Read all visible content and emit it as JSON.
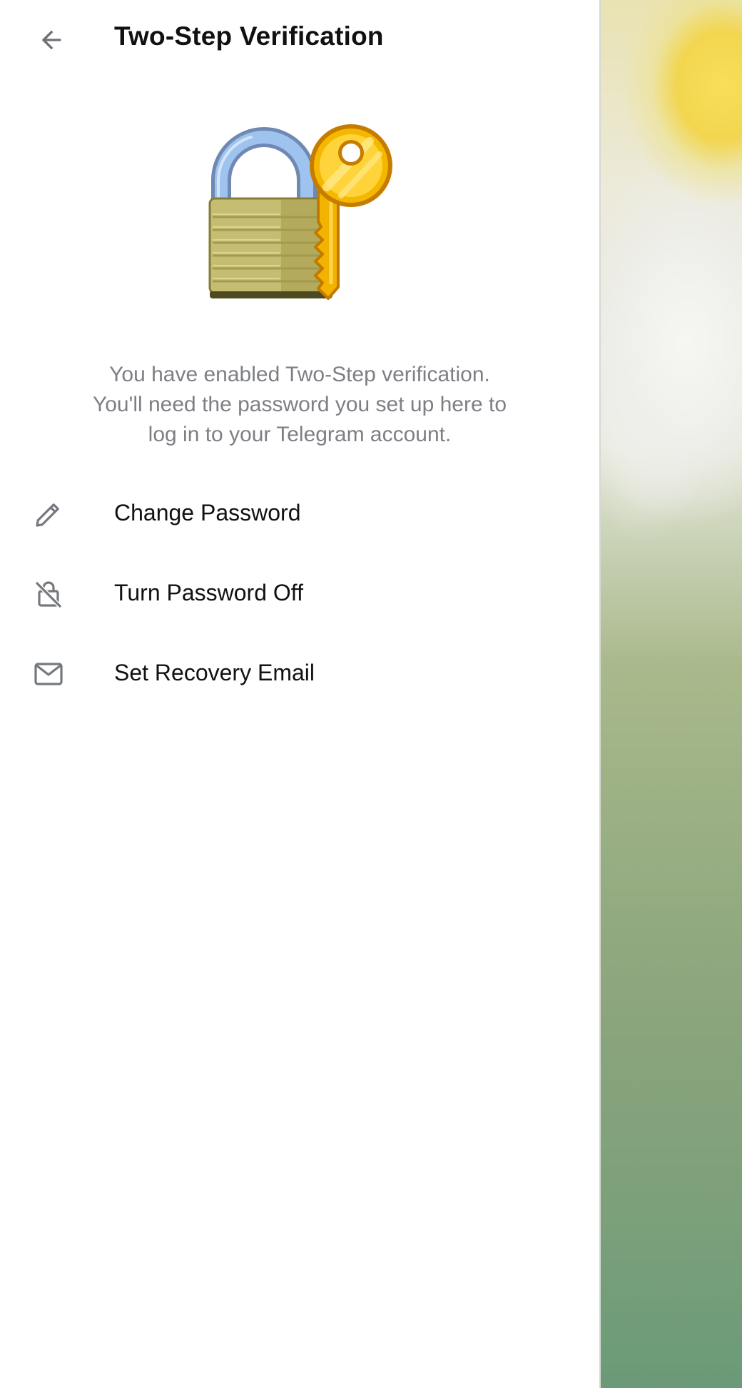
{
  "header": {
    "title": "Two-Step Verification",
    "back_icon": "arrow-left-icon"
  },
  "hero": {
    "icon": "lock-and-key-icon"
  },
  "description": {
    "line1": "You have enabled Two-Step verification.",
    "line2": "You'll need the password you set up here to",
    "line3": "log in to your Telegram account."
  },
  "menu": {
    "items": [
      {
        "label": "Change Password",
        "icon": "pencil-icon"
      },
      {
        "label": "Turn Password Off",
        "icon": "lock-off-icon"
      },
      {
        "label": "Set Recovery Email",
        "icon": "envelope-icon"
      }
    ]
  },
  "colors": {
    "background": "#ffffff",
    "title_text": "#111111",
    "secondary_text": "#7d7f85",
    "icon_gray": "#7a7d82",
    "key_gold": "#f4b400",
    "lock_body": "#c4bb6f",
    "lock_shackle": "#8fb4e6"
  }
}
